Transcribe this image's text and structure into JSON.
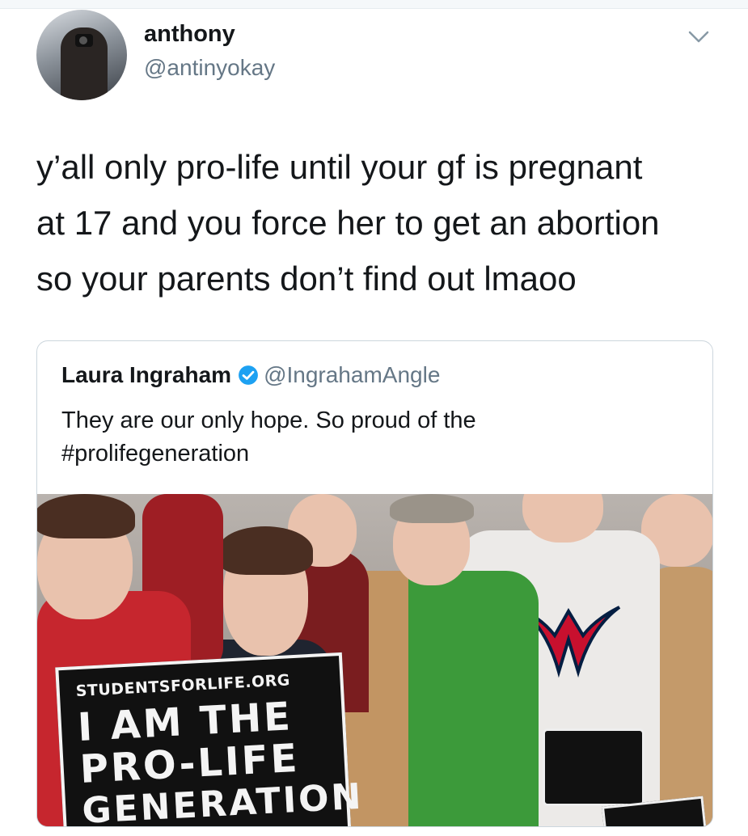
{
  "author": {
    "name": "anthony",
    "handle": "@antinyokay"
  },
  "tweet": {
    "lines": [
      "y’all only pro-life until your gf is pregnant",
      "at 17 and you force her to get an abortion",
      "so your parents don’t find out lmaoo"
    ]
  },
  "quoted": {
    "name": "Laura Ingraham",
    "handle": "@IngrahamAngle",
    "verified": true,
    "lines": [
      "They are our only hope.  So proud of the",
      "#prolifegeneration"
    ]
  },
  "photo": {
    "sign_small": "STUDENTSFORLIFE.ORG",
    "sign_line1": "I AM THE",
    "sign_line2": "PRO-LIFE",
    "sign_line3": "GENERATION"
  },
  "icons": {
    "menu": "chevron-down-icon",
    "verified": "verified-badge-icon"
  },
  "colors": {
    "text_primary": "#14171a",
    "text_secondary": "#657786",
    "verified_blue": "#1da1f2",
    "card_border": "#ccd6dd"
  }
}
